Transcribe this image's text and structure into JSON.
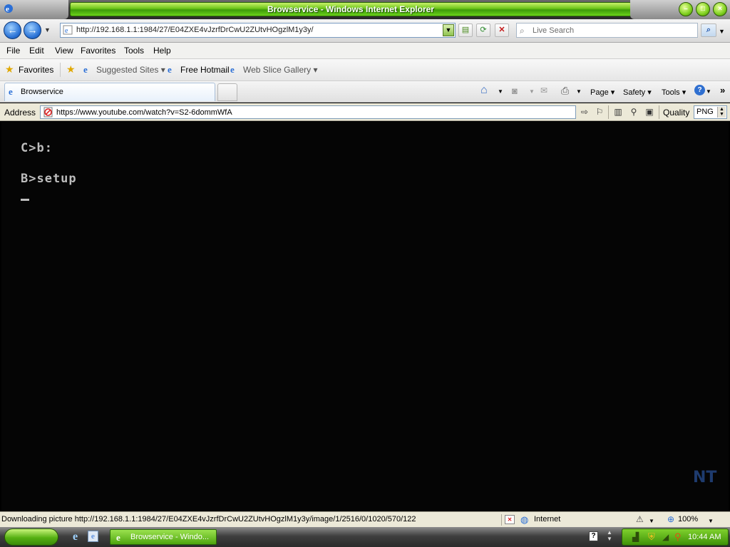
{
  "window": {
    "title": "Browservice - Windows Internet Explorer"
  },
  "nav": {
    "url": "http://192.168.1.1:1984/27/E04ZXE4vJzrfDrCwU2ZUtvHOgzlM1y3y/",
    "search_placeholder": "Live Search"
  },
  "menu": [
    "File",
    "Edit",
    "View",
    "Favorites",
    "Tools",
    "Help"
  ],
  "favorites_bar": {
    "favorites_label": "Favorites",
    "items": [
      "Suggested Sites ▾",
      "Free Hotmail",
      "Web Slice Gallery ▾"
    ]
  },
  "tabs": {
    "active_label": "Browservice"
  },
  "command_bar": {
    "page": "Page ▾",
    "safety": "Safety ▾",
    "tools": "Tools ▾",
    "help": "?",
    "more": "»"
  },
  "page_address": {
    "label": "Address",
    "url": "https://www.youtube.com/watch?v=S2-6dommWfA",
    "quality_label": "Quality",
    "quality_value": "PNG"
  },
  "console": {
    "lines": [
      "C>b:",
      "B>setup"
    ],
    "logo": "NT"
  },
  "status": {
    "text": "Downloading picture http://192.168.1.1:1984/27/E04ZXE4vJzrfDrCwU2ZUtvHOgzlM1y3y/image/1/2516/0/1020/570/122",
    "zone": "Internet",
    "zoom": "100%"
  },
  "taskbar": {
    "task_label": "Browservice - Windo...",
    "clock": "10:44 AM"
  },
  "colors": {
    "title_green": "#6bc418",
    "console_bg": "#050505",
    "console_text": "#bdbdbd"
  }
}
